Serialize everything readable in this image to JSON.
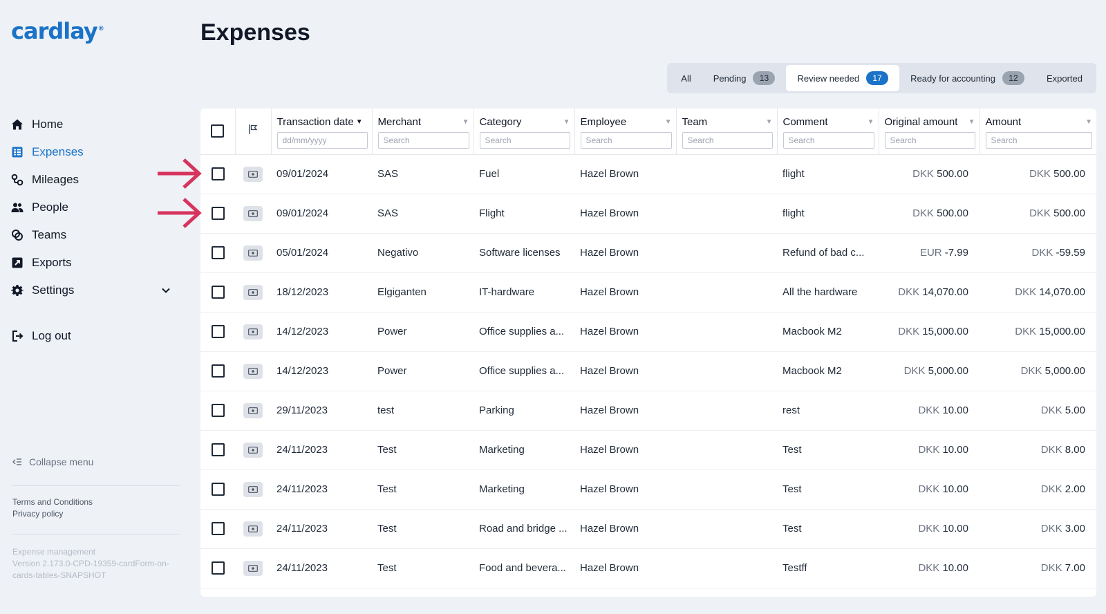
{
  "app": {
    "logo_text": "cardlay",
    "logo_mark": "®"
  },
  "sidebar": {
    "items": [
      {
        "label": "Home",
        "icon": "home-icon",
        "active": false
      },
      {
        "label": "Expenses",
        "icon": "expenses-icon",
        "active": true
      },
      {
        "label": "Mileages",
        "icon": "mileage-icon",
        "active": false
      },
      {
        "label": "People",
        "icon": "people-icon",
        "active": false
      },
      {
        "label": "Teams",
        "icon": "teams-icon",
        "active": false
      },
      {
        "label": "Exports",
        "icon": "exports-icon",
        "active": false
      },
      {
        "label": "Settings",
        "icon": "gear-icon",
        "active": false
      }
    ],
    "logout_label": "Log out",
    "collapse_label": "Collapse menu",
    "terms_label": "Terms and Conditions",
    "privacy_label": "Privacy policy",
    "version_line1": "Expense management",
    "version_line2": "Version 2.173.0-CPD-19359-cardForm-on-cards-tables-SNAPSHOT"
  },
  "page": {
    "title": "Expenses"
  },
  "tabs": [
    {
      "label": "All",
      "count": null,
      "active": false
    },
    {
      "label": "Pending",
      "count": "13",
      "active": false
    },
    {
      "label": "Review needed",
      "count": "17",
      "active": true
    },
    {
      "label": "Ready for accounting",
      "count": "12",
      "active": false
    },
    {
      "label": "Exported",
      "count": null,
      "active": false
    }
  ],
  "table": {
    "columns": {
      "date": {
        "label": "Transaction date",
        "placeholder": "dd/mm/yyyy"
      },
      "merchant": {
        "label": "Merchant",
        "placeholder": "Search"
      },
      "category": {
        "label": "Category",
        "placeholder": "Search"
      },
      "employee": {
        "label": "Employee",
        "placeholder": "Search"
      },
      "team": {
        "label": "Team",
        "placeholder": "Search"
      },
      "comment": {
        "label": "Comment",
        "placeholder": "Search"
      },
      "original_amount": {
        "label": "Original amount",
        "placeholder": "Search"
      },
      "amount": {
        "label": "Amount",
        "placeholder": "Search"
      }
    },
    "rows": [
      {
        "date": "09/01/2024",
        "merchant": "SAS",
        "category": "Fuel",
        "employee": "Hazel Brown",
        "team": "",
        "comment": "flight",
        "orig_cur": "DKK",
        "orig_val": "500.00",
        "amt_cur": "DKK",
        "amt_val": "500.00"
      },
      {
        "date": "09/01/2024",
        "merchant": "SAS",
        "category": "Flight",
        "employee": "Hazel Brown",
        "team": "",
        "comment": "flight",
        "orig_cur": "DKK",
        "orig_val": "500.00",
        "amt_cur": "DKK",
        "amt_val": "500.00"
      },
      {
        "date": "05/01/2024",
        "merchant": "Negativo",
        "category": "Software licenses",
        "employee": "Hazel Brown",
        "team": "",
        "comment": "Refund of bad c...",
        "orig_cur": "EUR",
        "orig_val": "-7.99",
        "amt_cur": "DKK",
        "amt_val": "-59.59"
      },
      {
        "date": "18/12/2023",
        "merchant": "Elgiganten",
        "category": "IT-hardware",
        "employee": "Hazel Brown",
        "team": "",
        "comment": "All the hardware",
        "orig_cur": "DKK",
        "orig_val": "14,070.00",
        "amt_cur": "DKK",
        "amt_val": "14,070.00"
      },
      {
        "date": "14/12/2023",
        "merchant": "Power",
        "category": "Office supplies a...",
        "employee": "Hazel Brown",
        "team": "",
        "comment": "Macbook M2",
        "orig_cur": "DKK",
        "orig_val": "15,000.00",
        "amt_cur": "DKK",
        "amt_val": "15,000.00"
      },
      {
        "date": "14/12/2023",
        "merchant": "Power",
        "category": "Office supplies a...",
        "employee": "Hazel Brown",
        "team": "",
        "comment": "Macbook M2",
        "orig_cur": "DKK",
        "orig_val": "5,000.00",
        "amt_cur": "DKK",
        "amt_val": "5,000.00"
      },
      {
        "date": "29/11/2023",
        "merchant": "test",
        "category": "Parking",
        "employee": "Hazel Brown",
        "team": "",
        "comment": "rest",
        "orig_cur": "DKK",
        "orig_val": "10.00",
        "amt_cur": "DKK",
        "amt_val": "5.00"
      },
      {
        "date": "24/11/2023",
        "merchant": "Test",
        "category": "Marketing",
        "employee": "Hazel Brown",
        "team": "",
        "comment": "Test",
        "orig_cur": "DKK",
        "orig_val": "10.00",
        "amt_cur": "DKK",
        "amt_val": "8.00"
      },
      {
        "date": "24/11/2023",
        "merchant": "Test",
        "category": "Marketing",
        "employee": "Hazel Brown",
        "team": "",
        "comment": "Test",
        "orig_cur": "DKK",
        "orig_val": "10.00",
        "amt_cur": "DKK",
        "amt_val": "2.00"
      },
      {
        "date": "24/11/2023",
        "merchant": "Test",
        "category": "Road and bridge ...",
        "employee": "Hazel Brown",
        "team": "",
        "comment": "Test",
        "orig_cur": "DKK",
        "orig_val": "10.00",
        "amt_cur": "DKK",
        "amt_val": "3.00"
      },
      {
        "date": "24/11/2023",
        "merchant": "Test",
        "category": "Food and bevera...",
        "employee": "Hazel Brown",
        "team": "",
        "comment": "Testff",
        "orig_cur": "DKK",
        "orig_val": "10.00",
        "amt_cur": "DKK",
        "amt_val": "7.00"
      }
    ]
  },
  "annotations": {
    "arrow_color": "#d6335d",
    "arrow_rows": [
      0,
      1
    ]
  },
  "colors": {
    "brand": "#1a73c7",
    "background": "#eef1f6"
  }
}
